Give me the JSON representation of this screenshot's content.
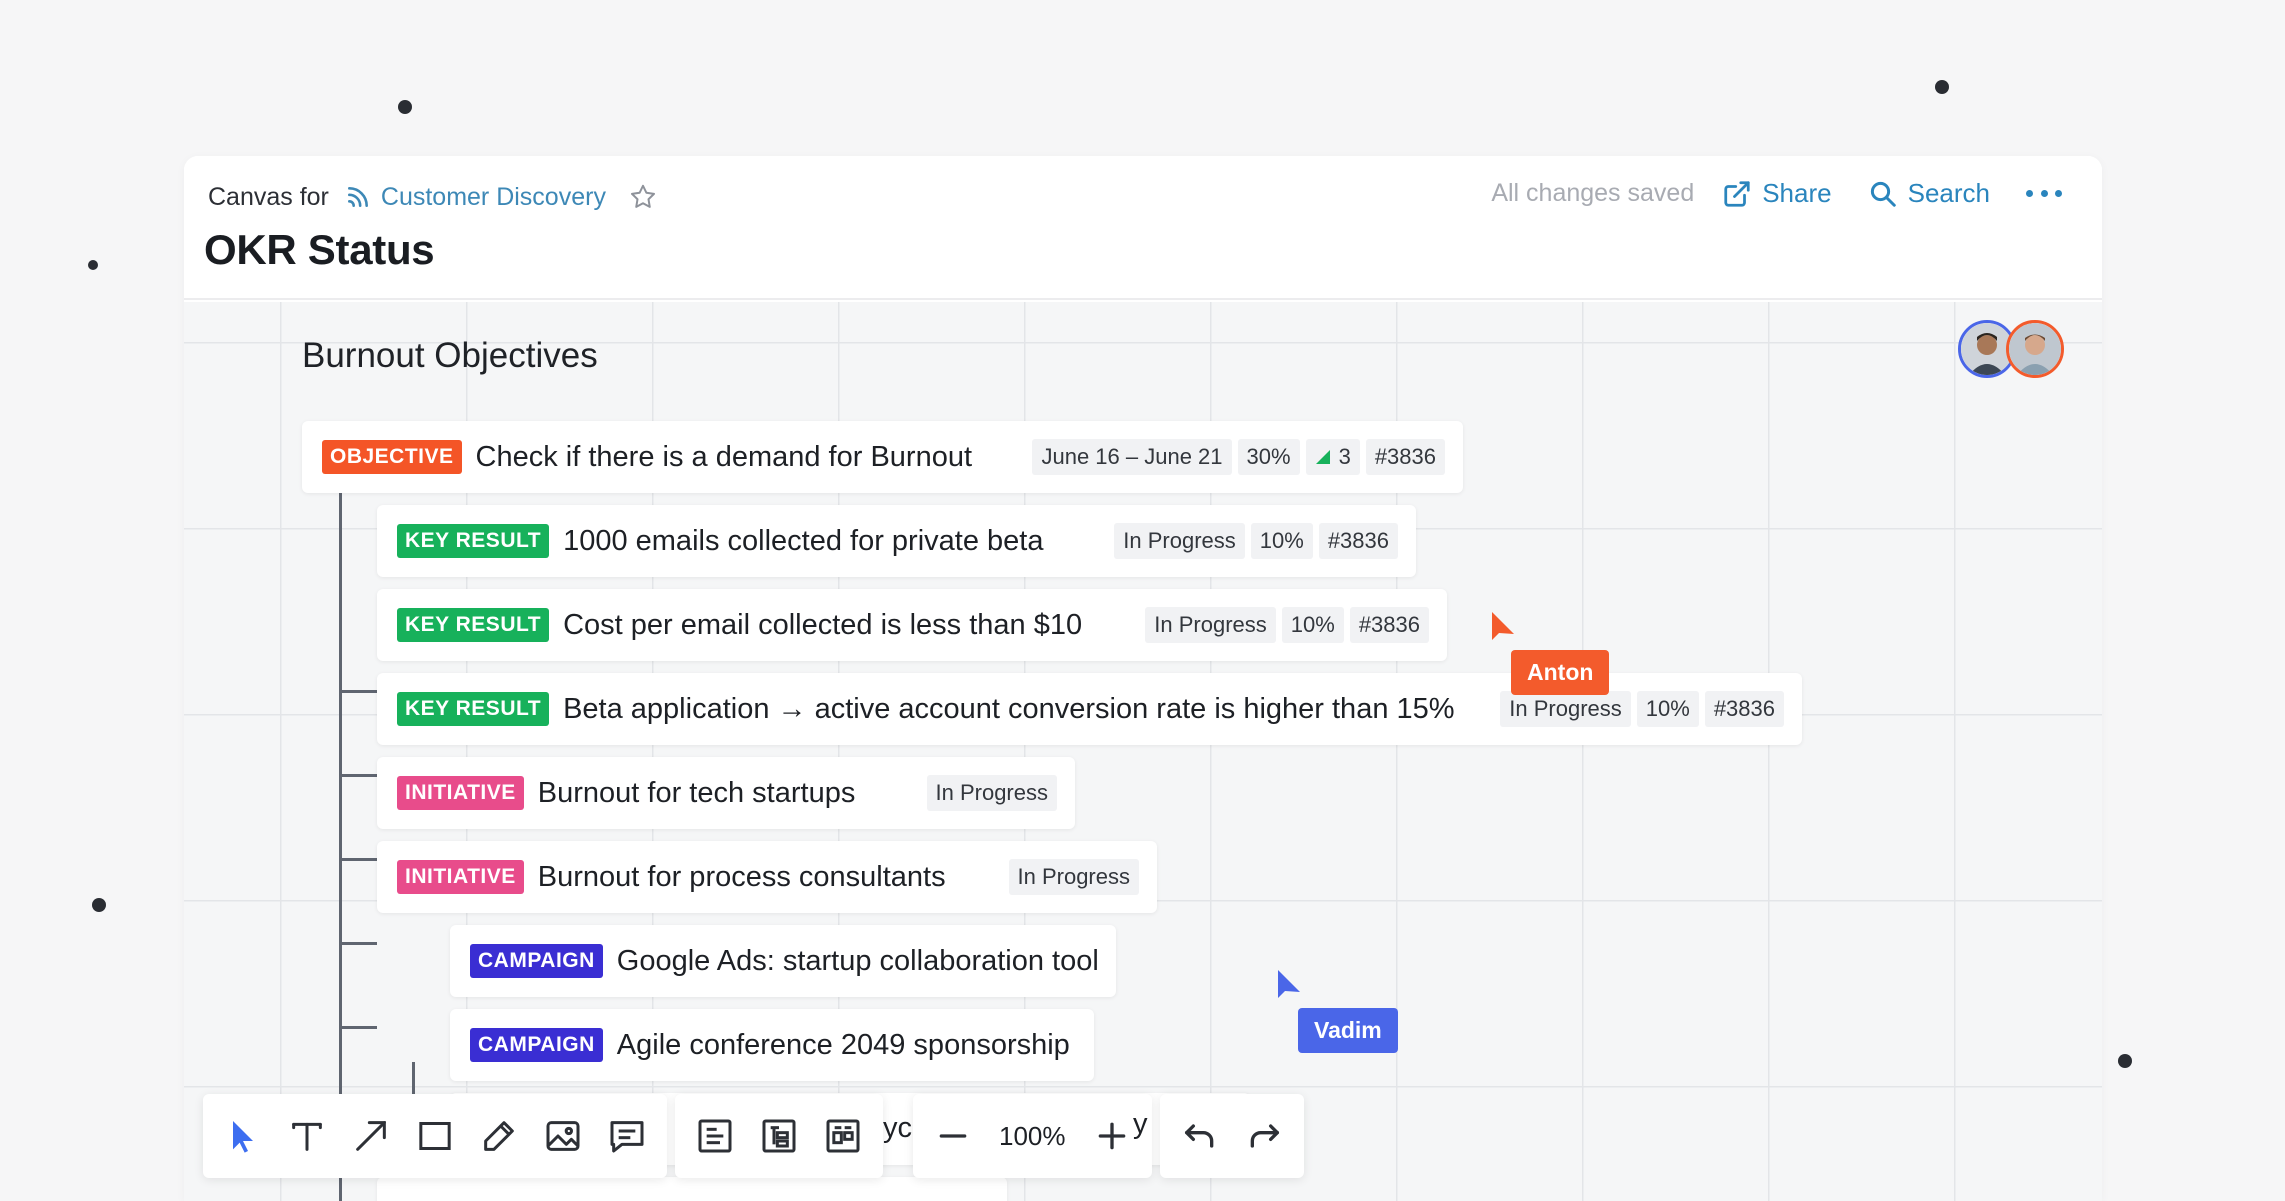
{
  "header": {
    "canvas_for": "Canvas for",
    "project": "Customer Discovery",
    "title": "OKR Status",
    "saved_status": "All changes saved",
    "share_label": "Share",
    "search_label": "Search"
  },
  "canvas": {
    "section_title": "Burnout Objectives",
    "objective": {
      "tag": "OBJECTIVE",
      "text": "Check if there is a demand for Burnout",
      "dates": "June 16 – June 21",
      "progress": "30%",
      "signals": "3",
      "id": "#3836"
    },
    "key_results": [
      {
        "tag": "KEY RESULT",
        "text": "1000 emails collected for private beta",
        "status": "In Progress",
        "progress": "10%",
        "id": "#3836"
      },
      {
        "tag": "KEY RESULT",
        "text": "Cost per email collected is less than $10",
        "status": "In Progress",
        "progress": "10%",
        "id": "#3836"
      },
      {
        "tag": "KEY RESULT",
        "text": "Beta application → active account conversion rate is higher than 15%",
        "status": "In Progress",
        "progress": "10%",
        "id": "#3836"
      }
    ],
    "initiatives": [
      {
        "tag": "INITIATIVE",
        "text": "Burnout for tech startups",
        "status": "In Progress"
      },
      {
        "tag": "INITIATIVE",
        "text": "Burnout for process consultants",
        "status": "In Progress"
      }
    ],
    "campaigns": [
      {
        "tag": "CAMPAIGN",
        "text": "Google Ads: startup collaboration tool"
      },
      {
        "tag": "CAMPAIGN",
        "text": "Agile conference 2049 sponsorship"
      }
    ],
    "peek_left": "yc",
    "peek_right": "y"
  },
  "cursors": [
    {
      "name": "Anton",
      "color": "#f35b2c"
    },
    {
      "name": "Vadim",
      "color": "#4a66e8"
    }
  ],
  "toolbar": {
    "zoom": "100%"
  },
  "colors": {
    "accent": "#2a85bd",
    "objective": "#f45527",
    "key_result": "#17b15b",
    "initiative": "#e84c8b",
    "campaign": "#3a2ed3"
  }
}
